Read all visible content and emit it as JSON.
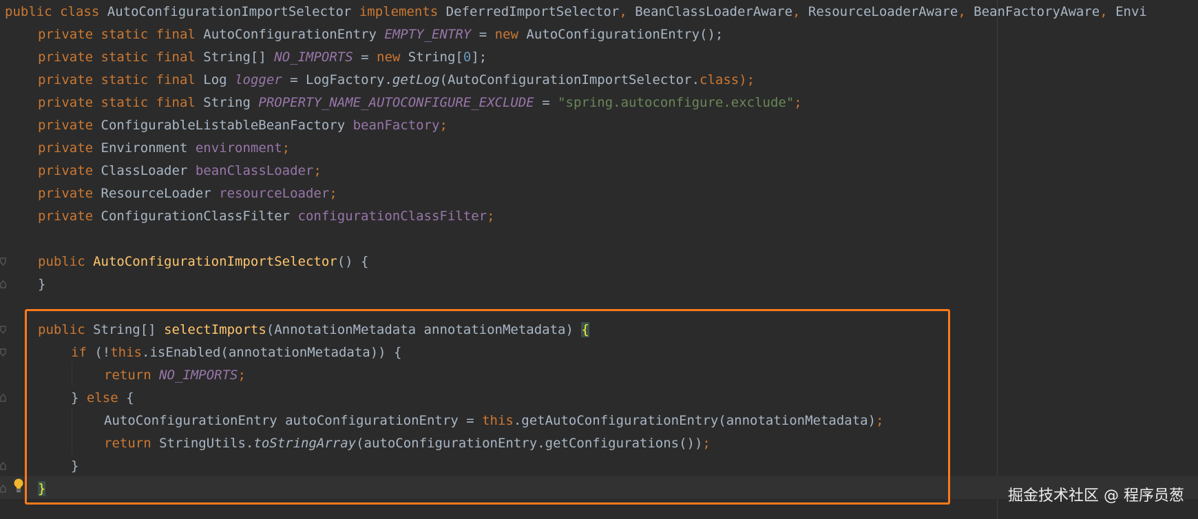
{
  "code": {
    "line1": {
      "t1": "public",
      "t2": "class",
      "t3": "AutoConfigurationImportSelector",
      "t4": "implements",
      "t5": "DeferredImportSelector",
      "t6": ",",
      "t7": "BeanClassLoaderAware",
      "t8": ",",
      "t9": "ResourceLoaderAware",
      "t10": ",",
      "t11": "BeanFactoryAware",
      "t12": ",",
      "t13": "Envi"
    },
    "line2": {
      "t1": "private",
      "t2": "static",
      "t3": "final",
      "t4": "AutoConfigurationEntry",
      "t5": "EMPTY_ENTRY",
      "t6": "=",
      "t7": "new",
      "t8": "AutoConfigurationEntry();"
    },
    "line3": {
      "t1": "private",
      "t2": "static",
      "t3": "final",
      "t4": "String[]",
      "t5": "NO_IMPORTS",
      "t6": "=",
      "t7": "new",
      "t8": "String[",
      "t9": "0",
      "t10": "];"
    },
    "line4": {
      "t1": "private",
      "t2": "static",
      "t3": "final",
      "t4": "Log",
      "t5": "logger",
      "t6": "= LogFactory.",
      "t7": "getLog",
      "t8": "(AutoConfigurationImportSelector.",
      "t9": "class",
      "t10": ");"
    },
    "line5": {
      "t1": "private",
      "t2": "static",
      "t3": "final",
      "t4": "String",
      "t5": "PROPERTY_NAME_AUTOCONFIGURE_EXCLUDE",
      "t6": "=",
      "t7": "\"spring.autoconfigure.exclude\"",
      "t8": ";"
    },
    "line6": {
      "t1": "private",
      "t2": "ConfigurableListableBeanFactory",
      "t3": "beanFactory",
      "t4": ";"
    },
    "line7": {
      "t1": "private",
      "t2": "Environment",
      "t3": "environment",
      "t4": ";"
    },
    "line8": {
      "t1": "private",
      "t2": "ClassLoader",
      "t3": "beanClassLoader",
      "t4": ";"
    },
    "line9": {
      "t1": "private",
      "t2": "ResourceLoader",
      "t3": "resourceLoader",
      "t4": ";"
    },
    "line10": {
      "t1": "private",
      "t2": "ConfigurationClassFilter",
      "t3": "configurationClassFilter",
      "t4": ";"
    },
    "line12": {
      "t1": "public",
      "t2": "AutoConfigurationImportSelector",
      "t3": "() {"
    },
    "line13": {
      "t1": "}"
    },
    "line15": {
      "t1": "public",
      "t2": "String[]",
      "t3": "selectImports",
      "t4": "(AnnotationMetadata annotationMetadata)",
      "t5": "{"
    },
    "line16": {
      "t1": "if",
      "t2": "(!",
      "t3": "this",
      "t4": ".isEnabled(annotationMetadata)) {"
    },
    "line17": {
      "t1": "return",
      "t2": "NO_IMPORTS",
      "t3": ";"
    },
    "line18": {
      "t1": "} ",
      "t2": "else",
      "t3": " {"
    },
    "line19": {
      "t1": "AutoConfigurationEntry autoConfigurationEntry =",
      "t2": "this",
      "t3": ".getAutoConfigurationEntry(annotationMetadata)",
      "t4": ";"
    },
    "line20": {
      "t1": "return",
      "t2": "StringUtils.",
      "t3": "toStringArray",
      "t4": "(autoConfigurationEntry.getConfigurations())",
      "t5": ";"
    },
    "line21": {
      "t1": "}"
    },
    "line22": {
      "t1": "}"
    }
  },
  "watermark": "掘金技术社区 @ 程序员葱",
  "colors": {
    "background": "#2b2b2b",
    "keyword": "#cc7832",
    "method": "#ffc66d",
    "field": "#9876aa",
    "string": "#6a8759",
    "number": "#6897bb",
    "text": "#a9b7c6",
    "highlight_border": "#ff7b1a"
  }
}
